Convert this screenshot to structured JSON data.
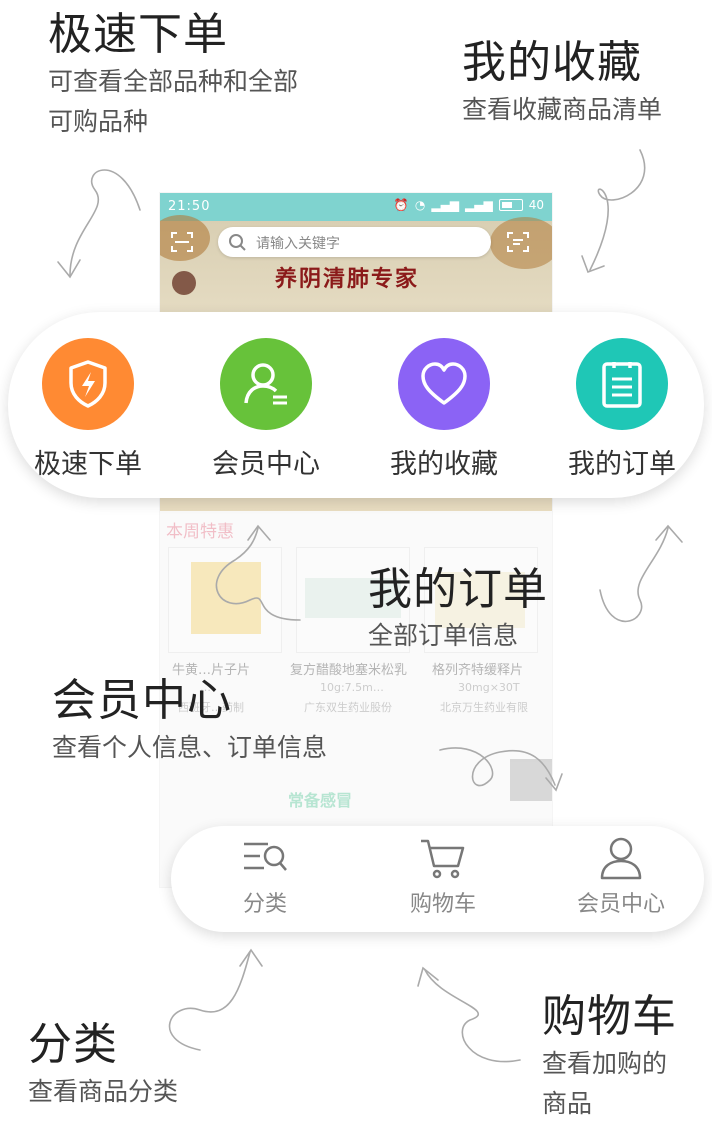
{
  "colors": {
    "status_bar": "#7fd3cf",
    "fast_order": "#ff8a33",
    "member": "#67c23a",
    "favorites": "#8b63f5",
    "orders": "#1fc7b6",
    "weekly_special": "#e2526a",
    "promo": "#3cbf8a"
  },
  "phone": {
    "status_bar": {
      "time": "21:50",
      "battery": "40",
      "icons": [
        "alarm-icon",
        "wifi-icon",
        "signal-icon",
        "signal-icon",
        "battery-icon"
      ]
    },
    "search": {
      "placeholder": "请输入关键字"
    },
    "banner": {
      "title": "养阴清肺专家"
    },
    "weekly_special": "本周特惠",
    "products": [
      {
        "name": "牛黄…片子片",
        "sub": "…",
        "maker": "西班牙…药制"
      },
      {
        "name": "复方醋酸地塞米松乳",
        "sub": "10g:7.5m…",
        "maker": "广东双生药业股份"
      },
      {
        "name": "格列齐特缓释片",
        "sub": "30mg×30T",
        "maker": "北京万生药业有限"
      }
    ],
    "promo": "常备感冒"
  },
  "features": [
    {
      "label": "极速下单",
      "icon": "lightning-shield-icon"
    },
    {
      "label": "会员中心",
      "icon": "user-icon"
    },
    {
      "label": "我的收藏",
      "icon": "heart-icon"
    },
    {
      "label": "我的订单",
      "icon": "clipboard-icon"
    }
  ],
  "tabs": [
    {
      "label": "分类",
      "icon": "category-search-icon"
    },
    {
      "label": "购物车",
      "icon": "cart-icon"
    },
    {
      "label": "会员中心",
      "icon": "user-icon"
    }
  ],
  "annotations": {
    "fast_order": {
      "title": "极速下单",
      "desc_line1": "可查看全部品种和全部",
      "desc_line2": "可购品种"
    },
    "favorites": {
      "title": "我的收藏",
      "desc": "查看收藏商品清单"
    },
    "orders": {
      "title": "我的订单",
      "desc": "全部订单信息"
    },
    "member": {
      "title": "会员中心",
      "desc": "查看个人信息、订单信息"
    },
    "category": {
      "title": "分类",
      "desc": "查看商品分类"
    },
    "cart": {
      "title": "购物车",
      "desc_line1": "查看加购的",
      "desc_line2": "商品"
    }
  }
}
